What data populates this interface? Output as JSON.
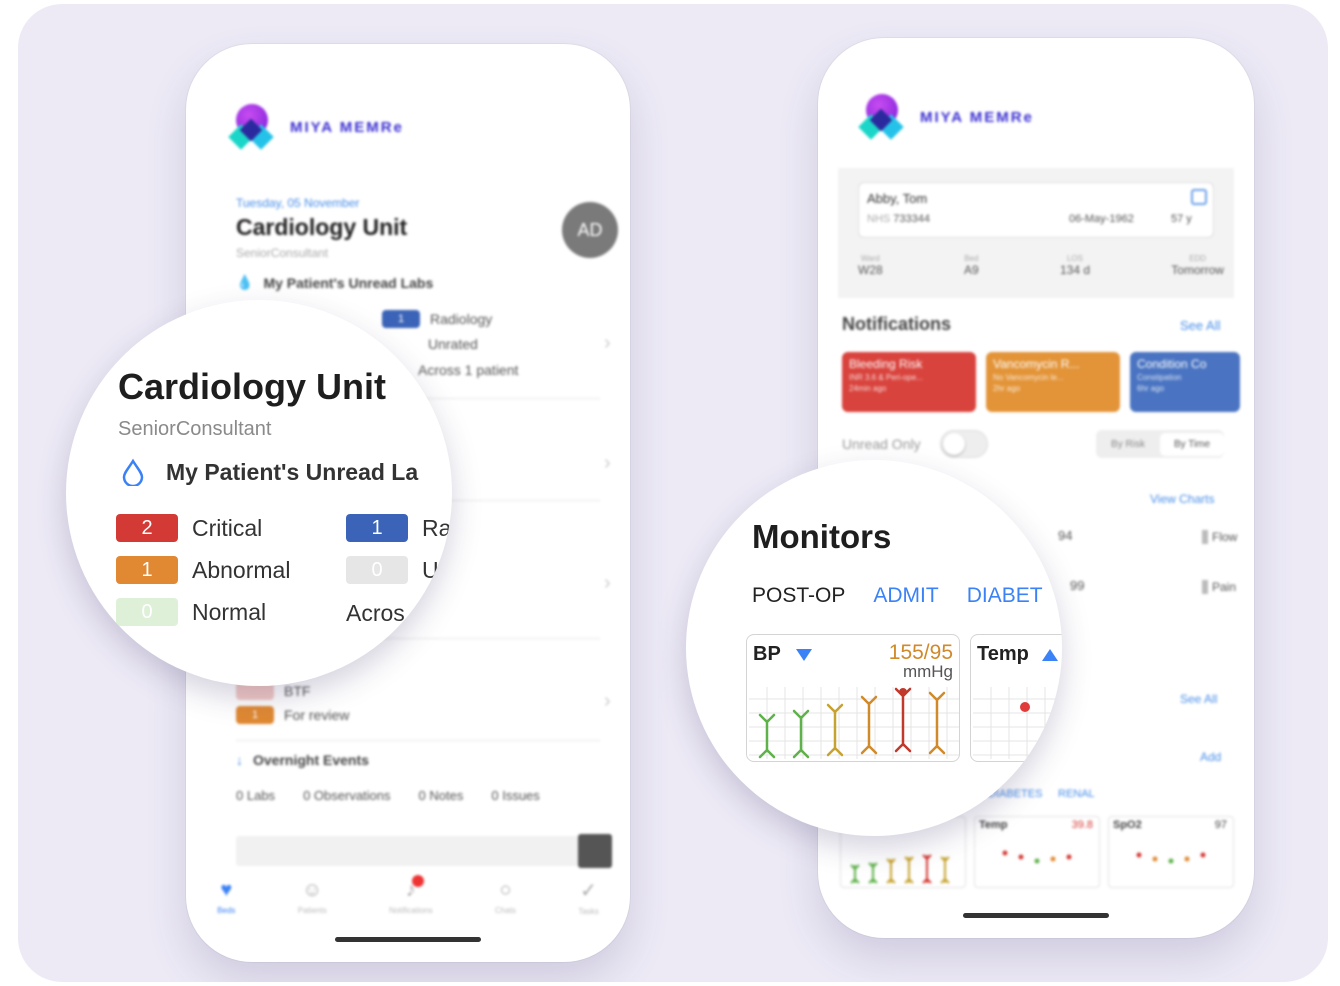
{
  "brand": {
    "name": "MIYA MEMRe"
  },
  "phone1": {
    "date": "Tuesday, 05 November",
    "unit": "Cardiology Unit",
    "role": "SeniorConsultant",
    "avatar": "AD",
    "labs_title": "My Patient's Unread Labs",
    "radiology": {
      "count": "1",
      "label": "Radiology"
    },
    "unrated": "Unrated",
    "across": "Across 1 patient",
    "btf": "BTF",
    "review": {
      "count": "1",
      "label": "For review"
    },
    "overnight_title": "Overnight Events",
    "events": [
      {
        "count": "0",
        "label": "Labs"
      },
      {
        "count": "0",
        "label": "Observations"
      },
      {
        "count": "0",
        "label": "Notes"
      },
      {
        "count": "0",
        "label": "Issues"
      }
    ],
    "tabs": [
      {
        "label": "Beds"
      },
      {
        "label": "Patients"
      },
      {
        "label": "Notifications"
      },
      {
        "label": "Chats"
      },
      {
        "label": "Tasks"
      }
    ]
  },
  "phone2": {
    "patient": {
      "name": "Abby, Tom",
      "nhs_label": "NHS",
      "nhs": "733344",
      "dob": "06-May-1962",
      "age": "57 y"
    },
    "stats": [
      {
        "label": "Ward",
        "value": "W28"
      },
      {
        "label": "Bed",
        "value": "A9"
      },
      {
        "label": "LOS",
        "value": "134 d"
      },
      {
        "label": "EDD",
        "value": "Tomorrow"
      }
    ],
    "notifications_title": "Notifications",
    "see_all": "See All",
    "cards": [
      {
        "title": "Bleeding Risk",
        "sub": "INR 3.6 & Peri-ope...",
        "time": "24min ago",
        "color": "#d9433d"
      },
      {
        "title": "Vancomycin R...",
        "sub": "No Vancomycin le...",
        "time": "2hr ago",
        "color": "#e39438"
      },
      {
        "title": "Condition Co",
        "sub": "Constipation",
        "time": "6hr ago",
        "color": "#4a74c2"
      }
    ],
    "unread_only": "Unread Only",
    "sort": {
      "by_risk": "By Risk",
      "by_time": "By Time"
    },
    "view_charts": "View Charts",
    "vitals": [
      {
        "value": "94"
      },
      {
        "value": "99"
      }
    ],
    "side": [
      {
        "label": "Flow"
      },
      {
        "label": "Pain"
      }
    ],
    "add": "Add",
    "tag_row": {
      "diabetes": "DIABETES",
      "renal": "RENAL"
    },
    "mini": [
      {
        "label": "Temp",
        "value": "39.8"
      },
      {
        "label": "SpO2",
        "value": "97"
      }
    ]
  },
  "zoom1": {
    "unit": "Cardiology Unit",
    "role": "SeniorConsultant",
    "labs_title": "My Patient's Unread La",
    "rows": [
      {
        "count": "2",
        "label": "Critical",
        "color": "#d33a35"
      },
      {
        "count": "1",
        "label": "Abnormal",
        "color": "#e08932"
      },
      {
        "count": "0",
        "label": "Normal",
        "color": "#dff0d8"
      }
    ],
    "right_rows": [
      {
        "count": "1",
        "label": "Ra",
        "color": "#3b64b8"
      },
      {
        "count": "0",
        "label": "U",
        "color": "#e6e6e6"
      },
      {
        "count": "",
        "label": "Acros",
        "color": ""
      }
    ]
  },
  "zoom2": {
    "title": "Monitors",
    "tabs": [
      {
        "label": "POST-OP",
        "active": false
      },
      {
        "label": "ADMIT",
        "active": true
      },
      {
        "label": "DIABET",
        "active": true
      }
    ],
    "bp": {
      "label": "BP",
      "value": "155/95",
      "unit": "mmHg"
    },
    "temp": {
      "label": "Temp"
    }
  },
  "colors": {
    "accent": "#3b82f6",
    "brand": "#3b2fd0",
    "critical": "#d33a35",
    "abnormal": "#e08932",
    "normal_green": "#5fb14a"
  }
}
